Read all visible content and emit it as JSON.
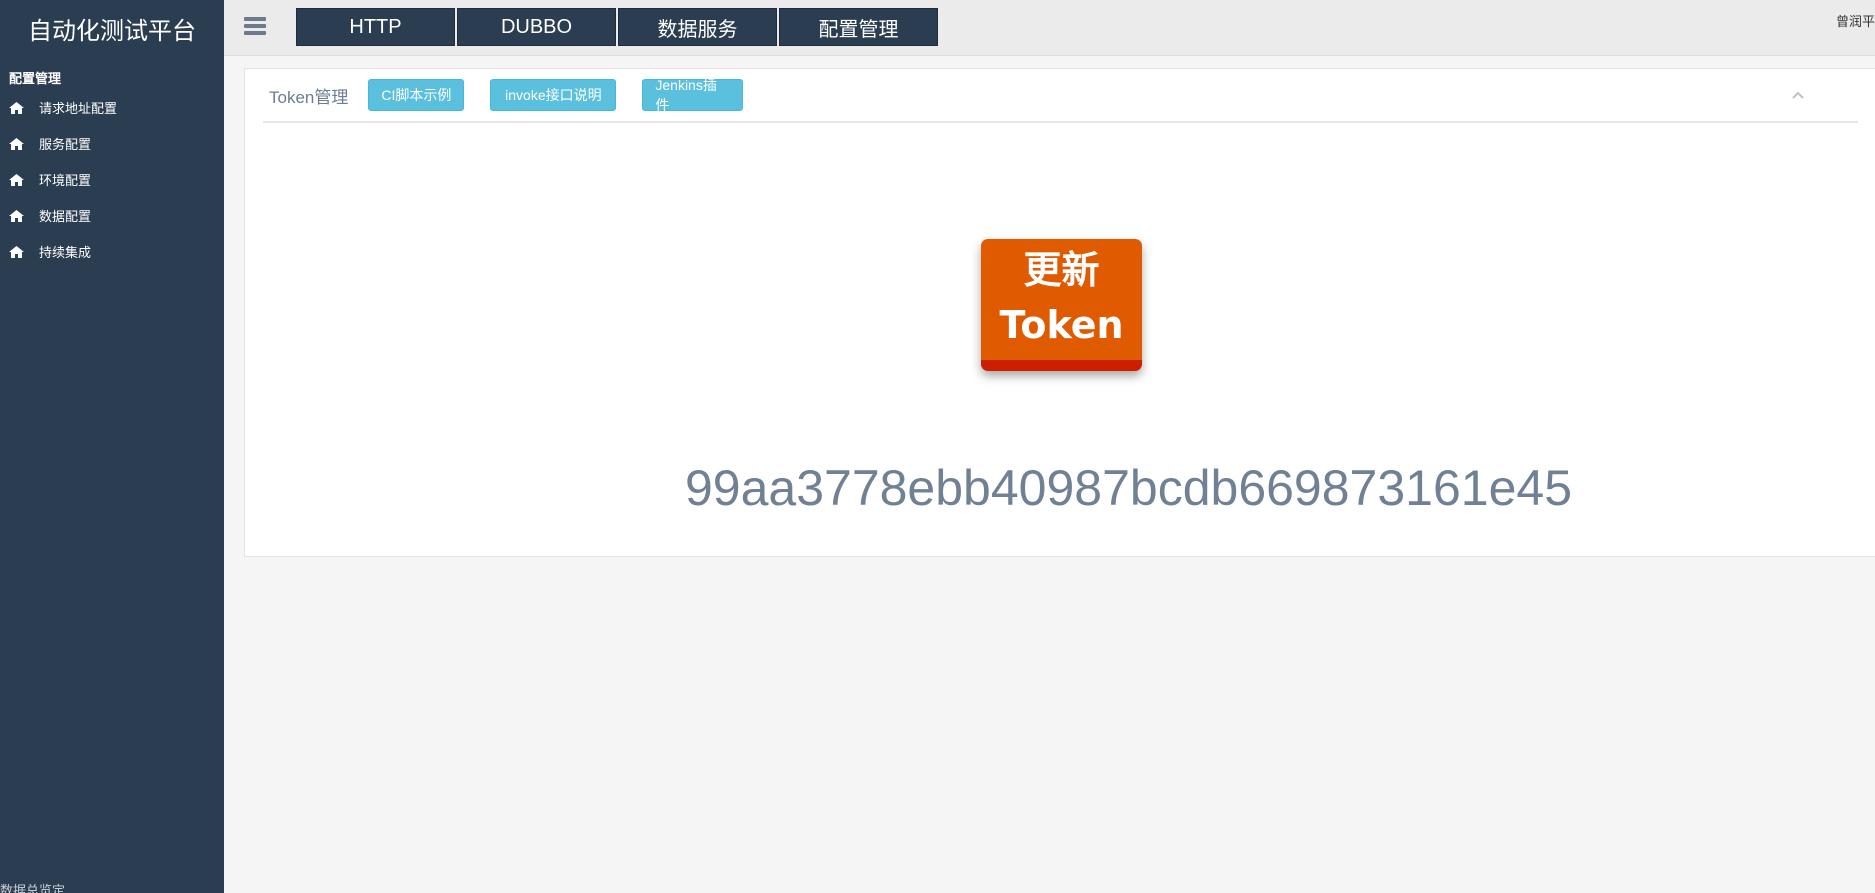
{
  "app": {
    "title": "自动化测试平台"
  },
  "topnav": {
    "tabs": [
      {
        "label": "HTTP"
      },
      {
        "label": "DUBBO"
      },
      {
        "label": "数据服务"
      },
      {
        "label": "配置管理"
      }
    ],
    "user": "曾润平"
  },
  "sidebar": {
    "section_title": "配置管理",
    "items": [
      {
        "label": "请求地址配置",
        "icon": "home-icon"
      },
      {
        "label": "服务配置",
        "icon": "home-icon"
      },
      {
        "label": "环境配置",
        "icon": "home-icon"
      },
      {
        "label": "数据配置",
        "icon": "home-icon"
      },
      {
        "label": "持续集成",
        "icon": "home-icon"
      }
    ],
    "footer": "数据总览定   ..."
  },
  "panel": {
    "title": "Token管理",
    "buttons": [
      {
        "label": "CI脚本示例"
      },
      {
        "label": "invoke接口说明"
      },
      {
        "label": "Jenkins插件"
      }
    ],
    "update_button": {
      "line1": "更新",
      "line2": "Token"
    },
    "token": "99aa3778ebb40987bcdb669873161e45"
  },
  "colors": {
    "sidebar_bg": "#2b3d51",
    "info_button": "#5bc0de",
    "update_button": "#e05a00",
    "token_text": "#708195"
  }
}
